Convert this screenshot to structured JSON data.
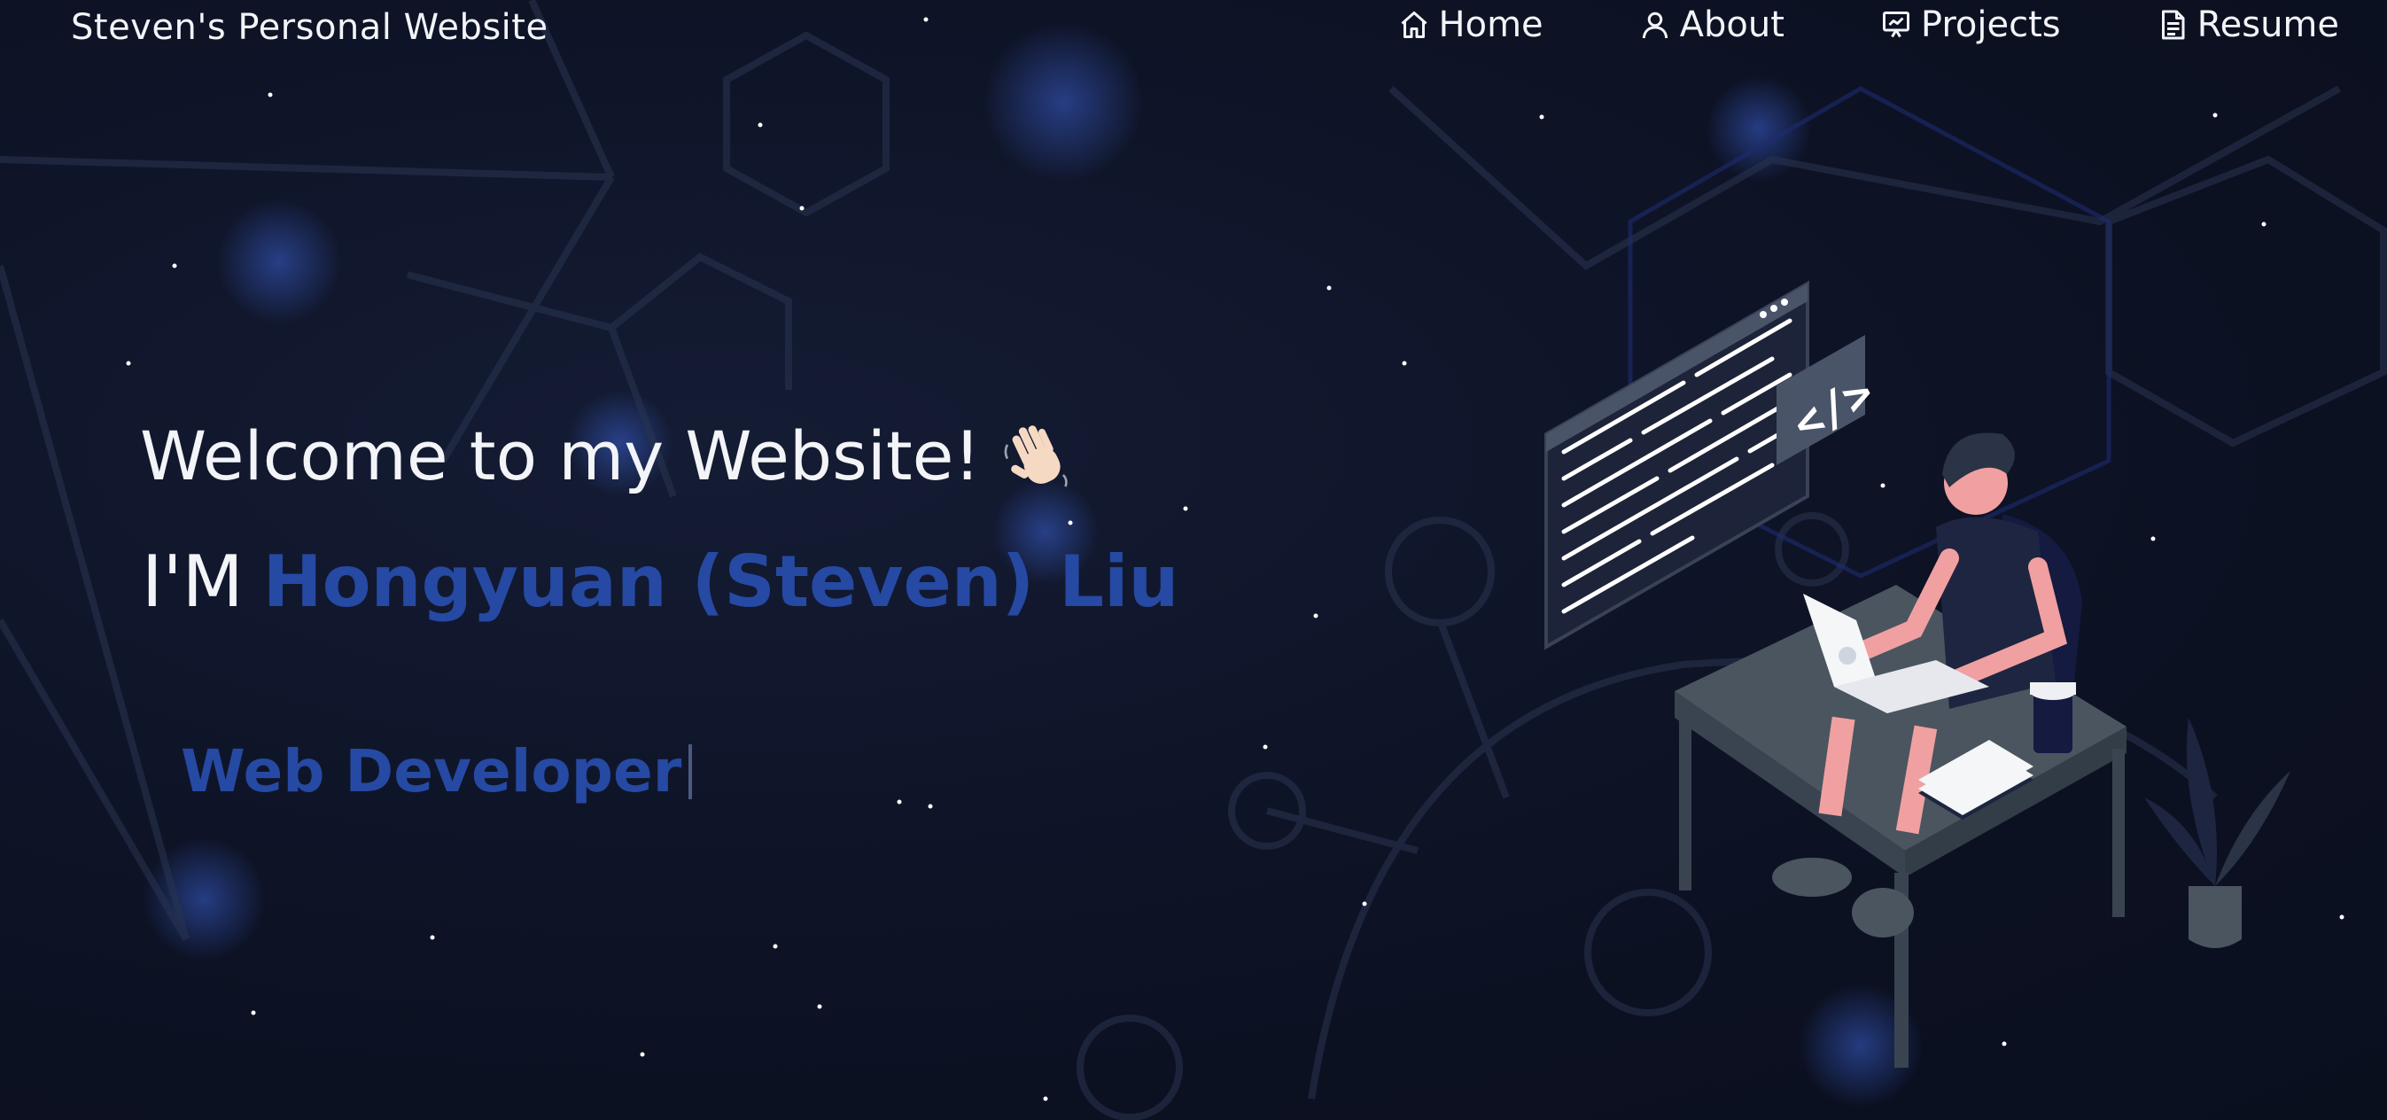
{
  "header": {
    "brand": "Steven's Personal Website",
    "nav": [
      {
        "label": "Home",
        "icon": "home-icon"
      },
      {
        "label": "About",
        "icon": "user-icon"
      },
      {
        "label": "Projects",
        "icon": "presentation-icon"
      },
      {
        "label": "Resume",
        "icon": "document-icon"
      }
    ]
  },
  "hero": {
    "welcome": "Welcome to my Website!",
    "im_prefix": "I'M",
    "name": "Hongyuan (Steven) Liu",
    "role": "Web Developer"
  },
  "illustration": {
    "code_tag": "</>"
  },
  "colors": {
    "background": "#0d1224",
    "accent": "#2649a3",
    "text": "#f3f4f7"
  }
}
